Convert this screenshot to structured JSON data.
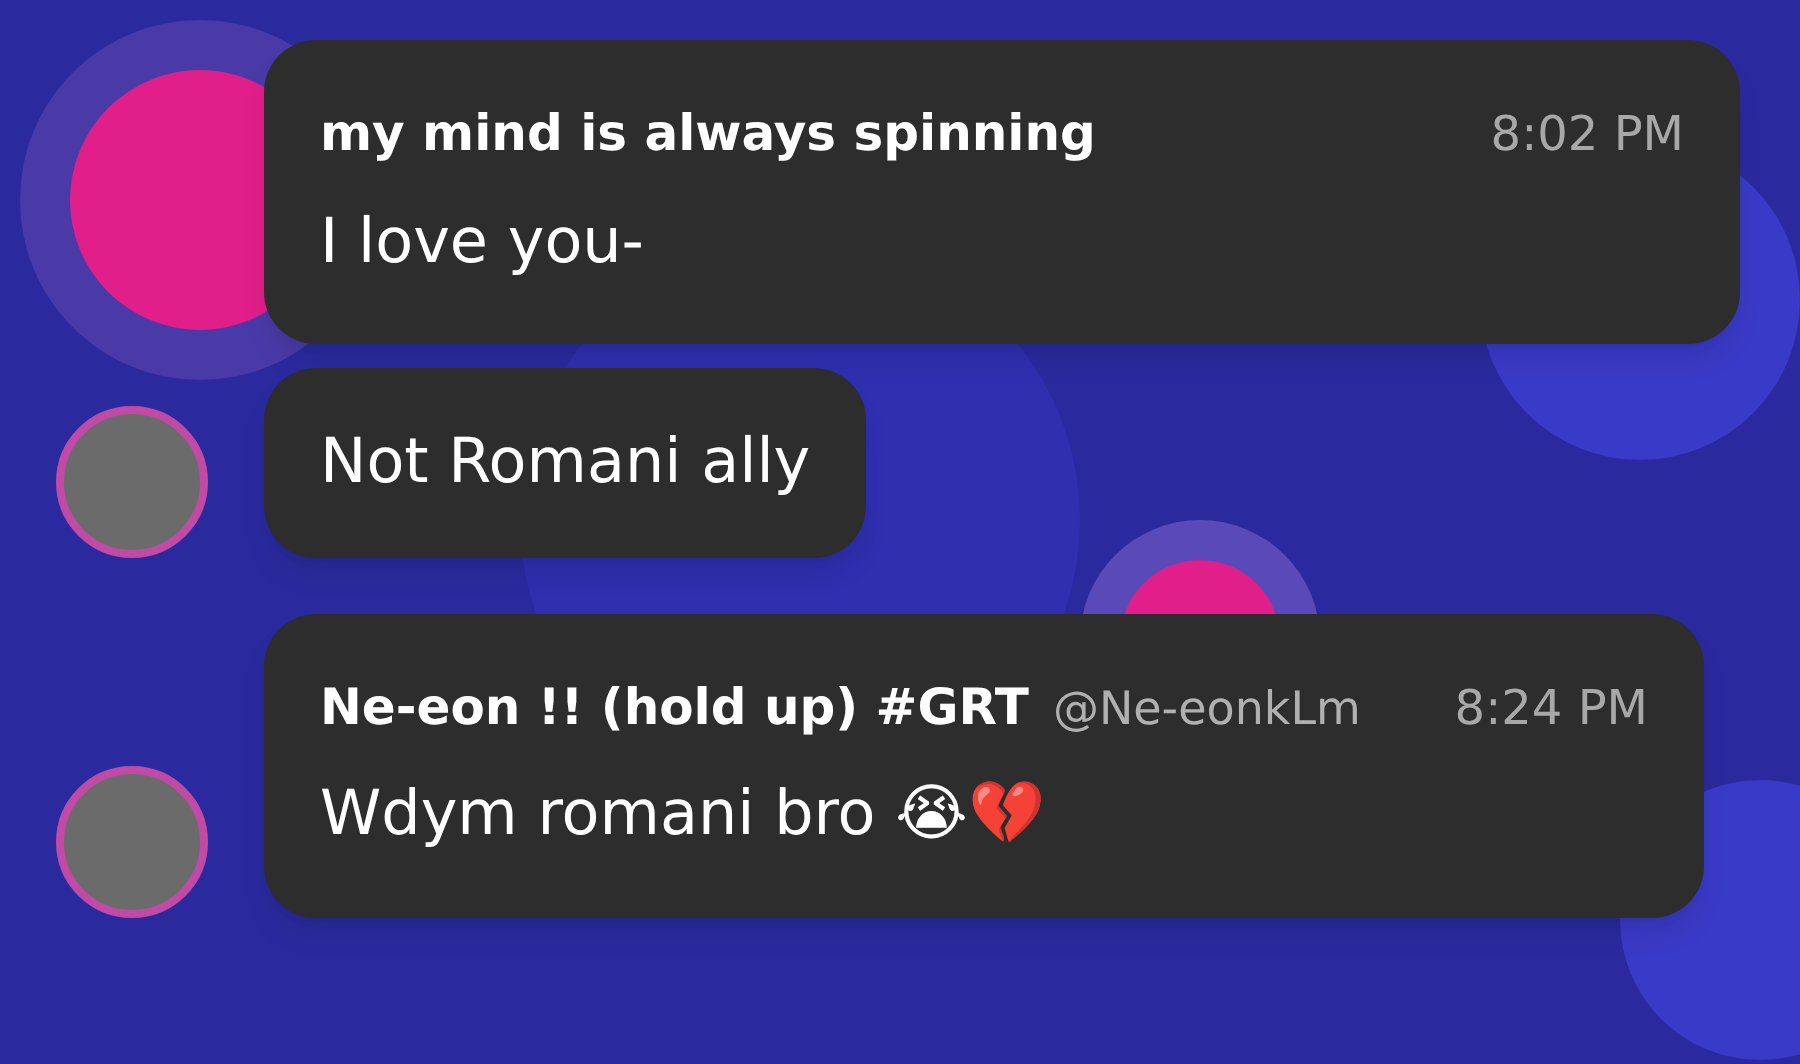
{
  "messages": [
    {
      "author": "my mind is always spinning",
      "time": "8:02 PM",
      "text": "I love you-",
      "avatar": false
    },
    {
      "text": "Not Romani ally",
      "avatar": true
    },
    {
      "author": "Ne-eon !! (hold up) #GRT",
      "handle": "@Ne-eonkLm",
      "time": "8:24 PM",
      "text": "Wdym romani bro 😭💔",
      "avatar": true
    }
  ]
}
